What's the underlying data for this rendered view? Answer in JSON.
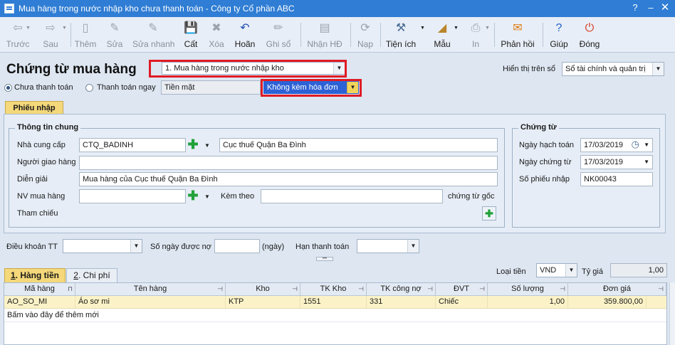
{
  "window": {
    "title": "Mua hàng trong nước nhập kho chưa thanh toán - Công ty Cổ phần ABC",
    "controls": [
      "?",
      "–",
      "□",
      "✕"
    ]
  },
  "toolbar": {
    "buttons": [
      {
        "label": "Trước",
        "icon": "arrow-left-icon",
        "enabled": false
      },
      {
        "label": "Sau",
        "icon": "arrow-right-icon",
        "enabled": false
      },
      {
        "label": "Thêm",
        "icon": "new-document-icon",
        "enabled": false
      },
      {
        "label": "Sửa",
        "icon": "edit-document-icon",
        "enabled": false
      },
      {
        "label": "Sửa nhanh",
        "icon": "quick-edit-icon",
        "enabled": false
      },
      {
        "label": "Cất",
        "icon": "save-icon",
        "enabled": true
      },
      {
        "label": "Xóa",
        "icon": "delete-icon",
        "enabled": false
      },
      {
        "label": "Hoãn",
        "icon": "undo-icon",
        "enabled": true
      },
      {
        "label": "Ghi sổ",
        "icon": "pencil-icon",
        "enabled": false
      },
      {
        "label": "Nhận HĐ",
        "icon": "invoice-icon",
        "enabled": false
      },
      {
        "label": "Nạp",
        "icon": "reload-icon",
        "enabled": false
      },
      {
        "label": "Tiện ích",
        "icon": "tools-icon",
        "enabled": true
      },
      {
        "label": "Mẫu",
        "icon": "template-icon",
        "enabled": true
      },
      {
        "label": "In",
        "icon": "print-icon",
        "enabled": false
      },
      {
        "label": "Phản hồi",
        "icon": "mail-icon",
        "enabled": true
      },
      {
        "label": "Giúp",
        "icon": "help-icon",
        "enabled": true
      },
      {
        "label": "Đóng",
        "icon": "close-icon",
        "enabled": true
      }
    ]
  },
  "header": {
    "title": "Chứng từ mua hàng",
    "purchase_type": "1. Mua hàng trong nước nhập kho",
    "display_label": "Hiển thị trên sổ",
    "display_value": "Sổ tài chính và quản trị",
    "radio_unpaid": "Chưa thanh toán",
    "radio_paid": "Thanh toán ngay",
    "payment_method": "Tiền mặt",
    "invoice_option": "Không kèm hóa đơn"
  },
  "tab_phieu_nhap": "Phiếu nhập",
  "general": {
    "legend": "Thông tin chung",
    "supplier_label": "Nhà cung cấp",
    "supplier_code": "CTQ_BADINH",
    "supplier_name": "Cục thuế Quận Ba Đình",
    "deliverer_label": "Người giao hàng",
    "deliverer_value": "",
    "description_label": "Diễn giải",
    "description_value": "Mua hàng của Cục thuế Quận Ba Đình",
    "buyer_label": "NV mua hàng",
    "buyer_value": "",
    "attach_label": "Kèm theo",
    "attach_value": "",
    "attach_suffix": "chứng từ gốc",
    "reference_label": "Tham chiếu"
  },
  "voucher": {
    "legend": "Chứng từ",
    "posting_date_label": "Ngày hạch toán",
    "posting_date": "17/03/2019",
    "voucher_date_label": "Ngày chứng từ",
    "voucher_date": "17/03/2019",
    "receipt_no_label": "Số phiếu nhập",
    "receipt_no": "NK00043"
  },
  "terms": {
    "payment_terms_label": "Điều khoản TT",
    "payment_terms": "",
    "credit_days_label": "Số ngày được nợ",
    "credit_days": "",
    "days_unit": "(ngày)",
    "due_date_label": "Hạn thanh toán",
    "due_date": ""
  },
  "detail_tabs": {
    "tab1_key": "1",
    "tab1_rest": ". Hàng tiền",
    "tab2_key": "2",
    "tab2_rest": ". Chi phí",
    "currency_label": "Loại tiền",
    "currency": "VND",
    "rate_label": "Tỷ giá",
    "rate": "1,00"
  },
  "grid": {
    "columns": [
      "Mã hàng",
      "Tên hàng",
      "Kho",
      "TK Kho",
      "TK công nợ",
      "ĐVT",
      "Số lượng",
      "Đơn giá"
    ],
    "rows": [
      [
        "AO_SO_MI",
        "Áo sơ mi",
        "KTP",
        "1551",
        "331",
        "Chiếc",
        "1,00",
        "359.800,00"
      ]
    ],
    "add_new": "Bấm vào đây để thêm mới"
  },
  "colors": {
    "titlebar": "#2f7dd4",
    "highlight": "#e01b24",
    "selected_combo": "#2d62d6",
    "active_tab": "#f4d87a",
    "row_highlight": "#fbf3c7"
  }
}
